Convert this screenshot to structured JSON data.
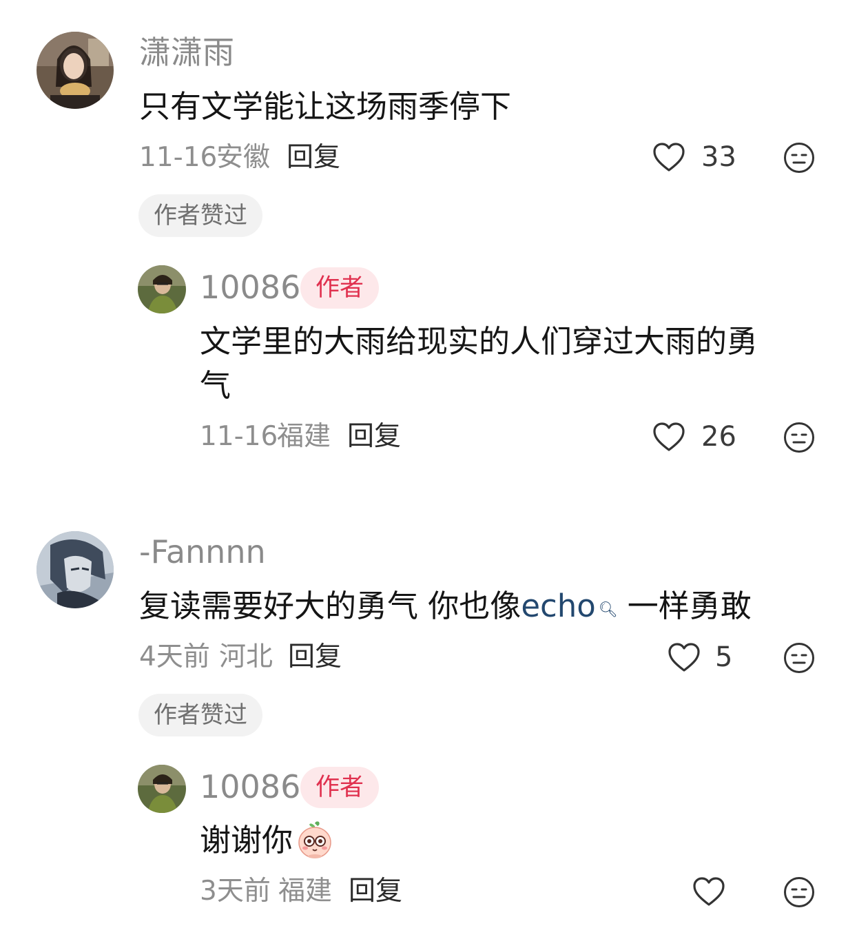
{
  "comments": [
    {
      "username": "潇潇雨",
      "text": "只有文学能让这场雨季停下",
      "date": "11-16",
      "location": "安徽",
      "reply_label": "回复",
      "likes": "33",
      "liked_by_author": "作者赞过",
      "replies": [
        {
          "username": "10086",
          "author_tag": "作者",
          "text_line1": "文学里的大雨给现实的人们穿过大雨的勇",
          "text_line2": "气",
          "date": "11-16",
          "location": "福建",
          "reply_label": "回复",
          "likes": "26"
        }
      ]
    },
    {
      "username": "-Fannnn",
      "text_before": "复读需要好大的勇气 你也像",
      "link": "echo",
      "text_after": "一样勇敢",
      "date": "4天前",
      "location": "河北",
      "reply_label": "回复",
      "likes": "5",
      "liked_by_author": "作者赞过",
      "replies": [
        {
          "username": "10086",
          "author_tag": "作者",
          "text": "谢谢你",
          "date": "3天前",
          "location": "福建",
          "reply_label": "回复",
          "likes": ""
        }
      ]
    }
  ],
  "colors": {
    "username": "#8a8a8a",
    "author_tag_bg": "#fde8ea",
    "author_tag_text": "#e0314f",
    "link": "#23486f",
    "chip_bg": "#f2f2f2"
  },
  "icons": [
    "heart-outline-icon",
    "dislike-face-icon",
    "search-icon",
    "emoji-sticker-icon"
  ]
}
